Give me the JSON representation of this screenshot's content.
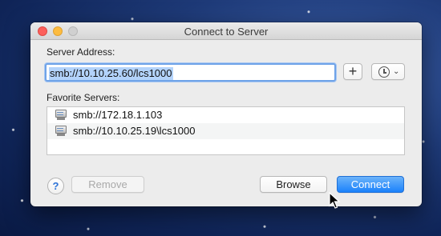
{
  "window": {
    "title": "Connect to Server"
  },
  "server_address": {
    "label": "Server Address:",
    "value": "smb://10.10.25.60/lcs1000"
  },
  "add_button": {
    "label": "+"
  },
  "favorites": {
    "label": "Favorite Servers:",
    "items": [
      {
        "text": "smb://172.18.1.103"
      },
      {
        "text": "smb://10.10.25.19\\lcs1000"
      }
    ]
  },
  "footer": {
    "help_label": "?",
    "remove_label": "Remove",
    "browse_label": "Browse",
    "connect_label": "Connect"
  },
  "icons": {
    "recent_servers": "clock-icon",
    "dropdown": "chevron-down-icon",
    "server": "server-icon",
    "cursor": "mouse-pointer-icon"
  },
  "colors": {
    "accent": "#1b82fb",
    "selection": "#b3d3fb",
    "close": "#fc605b",
    "minimize": "#fdbc40"
  }
}
